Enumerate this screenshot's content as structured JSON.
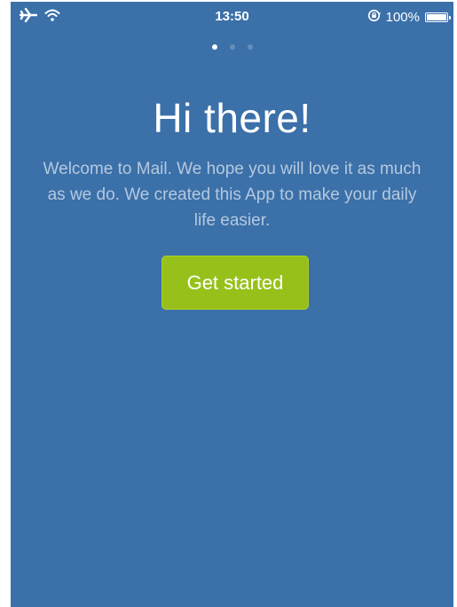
{
  "status_bar": {
    "time": "13:50",
    "battery_text": "100%",
    "battery_level": 1.0,
    "icons": [
      "airplane-icon",
      "wifi-icon",
      "rotation-lock-icon",
      "battery-icon"
    ]
  },
  "pager": {
    "pages": 3,
    "current": 1
  },
  "onboarding": {
    "title": "Hi there!",
    "message": "Welcome to Mail. We hope you will love it as much as we do. We created this App to make your daily life easier.",
    "cta_label": "Get started"
  },
  "colors": {
    "background": "#3b70a9",
    "cta": "#97c11a",
    "text": "#ffffff"
  }
}
